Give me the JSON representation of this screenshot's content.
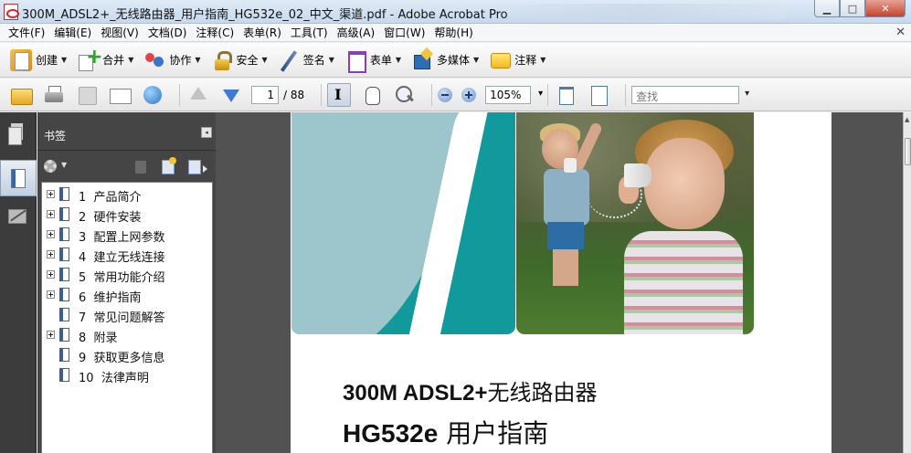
{
  "window": {
    "title": "300M_ADSL2+_无线路由器_用户指南_HG532e_02_中文_渠道.pdf - Adobe Acrobat Pro"
  },
  "menu": [
    "文件(F)",
    "编辑(E)",
    "视图(V)",
    "文档(D)",
    "注释(C)",
    "表单(R)",
    "工具(T)",
    "高级(A)",
    "窗口(W)",
    "帮助(H)"
  ],
  "toolbar": {
    "create": "创建",
    "merge": "合并",
    "collaborate": "协作",
    "secure": "安全",
    "sign": "签名",
    "forms": "表单",
    "multimedia": "多媒体",
    "comment": "注释"
  },
  "nav": {
    "current_page": "1",
    "total_pages": "/ 88",
    "zoom": "105%",
    "search_placeholder": "查找"
  },
  "bookmarks": {
    "header": "书签",
    "items": [
      {
        "num": "1",
        "label": "产品简介"
      },
      {
        "num": "2",
        "label": "硬件安装"
      },
      {
        "num": "3",
        "label": "配置上网参数"
      },
      {
        "num": "4",
        "label": "建立无线连接"
      },
      {
        "num": "5",
        "label": "常用功能介绍"
      },
      {
        "num": "6",
        "label": "维护指南"
      },
      {
        "num": "7",
        "label": "常见问题解答"
      },
      {
        "num": "8",
        "label": "附录"
      },
      {
        "num": "9",
        "label": "获取更多信息"
      },
      {
        "num": "10",
        "label": "法律声明"
      }
    ]
  },
  "document": {
    "title_line1_en": "300M ADSL2+",
    "title_line1_cn": "无线路由器",
    "title_line2_en": "HG532e",
    "title_line2_cn": " 用户指南"
  },
  "colors": {
    "teal": "#12999b",
    "panel_dark": "#454545",
    "doc_background": "#525252"
  }
}
